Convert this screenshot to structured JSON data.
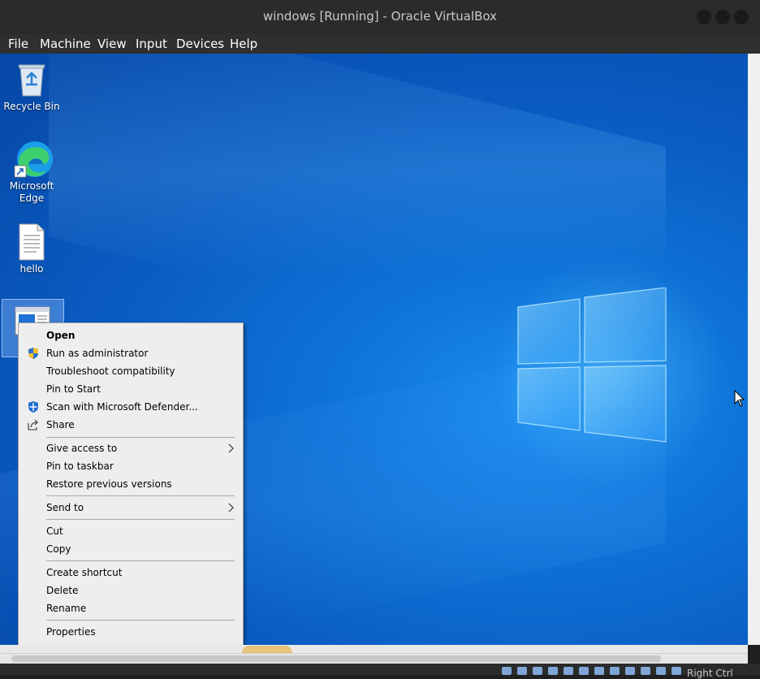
{
  "window": {
    "title": "windows [Running] - Oracle VirtualBox"
  },
  "menubar": {
    "items": [
      "File",
      "Machine",
      "View",
      "Input",
      "Devices",
      "Help"
    ]
  },
  "desktop": {
    "icons": [
      {
        "label": "Recycle Bin",
        "icon": "recycle-bin-icon"
      },
      {
        "label": "Microsoft Edge",
        "icon": "edge-icon"
      },
      {
        "label": "hello",
        "icon": "text-file-icon"
      },
      {
        "label": "",
        "icon": "application-icon"
      }
    ]
  },
  "context_menu": {
    "items": [
      {
        "label": "Open",
        "bold": true
      },
      {
        "label": "Run as administrator",
        "icon": "shield-icon"
      },
      {
        "label": "Troubleshoot compatibility"
      },
      {
        "label": "Pin to Start"
      },
      {
        "label": "Scan with Microsoft Defender...",
        "icon": "defender-icon"
      },
      {
        "label": "Share",
        "icon": "share-icon"
      },
      {
        "label": "Give access to",
        "submenu": true
      },
      {
        "label": "Pin to taskbar"
      },
      {
        "label": "Restore previous versions"
      },
      {
        "label": "Send to",
        "submenu": true
      },
      {
        "label": "Cut"
      },
      {
        "label": "Copy"
      },
      {
        "label": "Create shortcut"
      },
      {
        "label": "Delete"
      },
      {
        "label": "Rename"
      },
      {
        "label": "Properties"
      }
    ]
  },
  "statusbar": {
    "host_key": "Right Ctrl"
  },
  "colors": {
    "desktop_blue": "#0a5cc2",
    "menu_bg": "#eeeeee",
    "titlebar_bg": "#2b2b2b"
  }
}
